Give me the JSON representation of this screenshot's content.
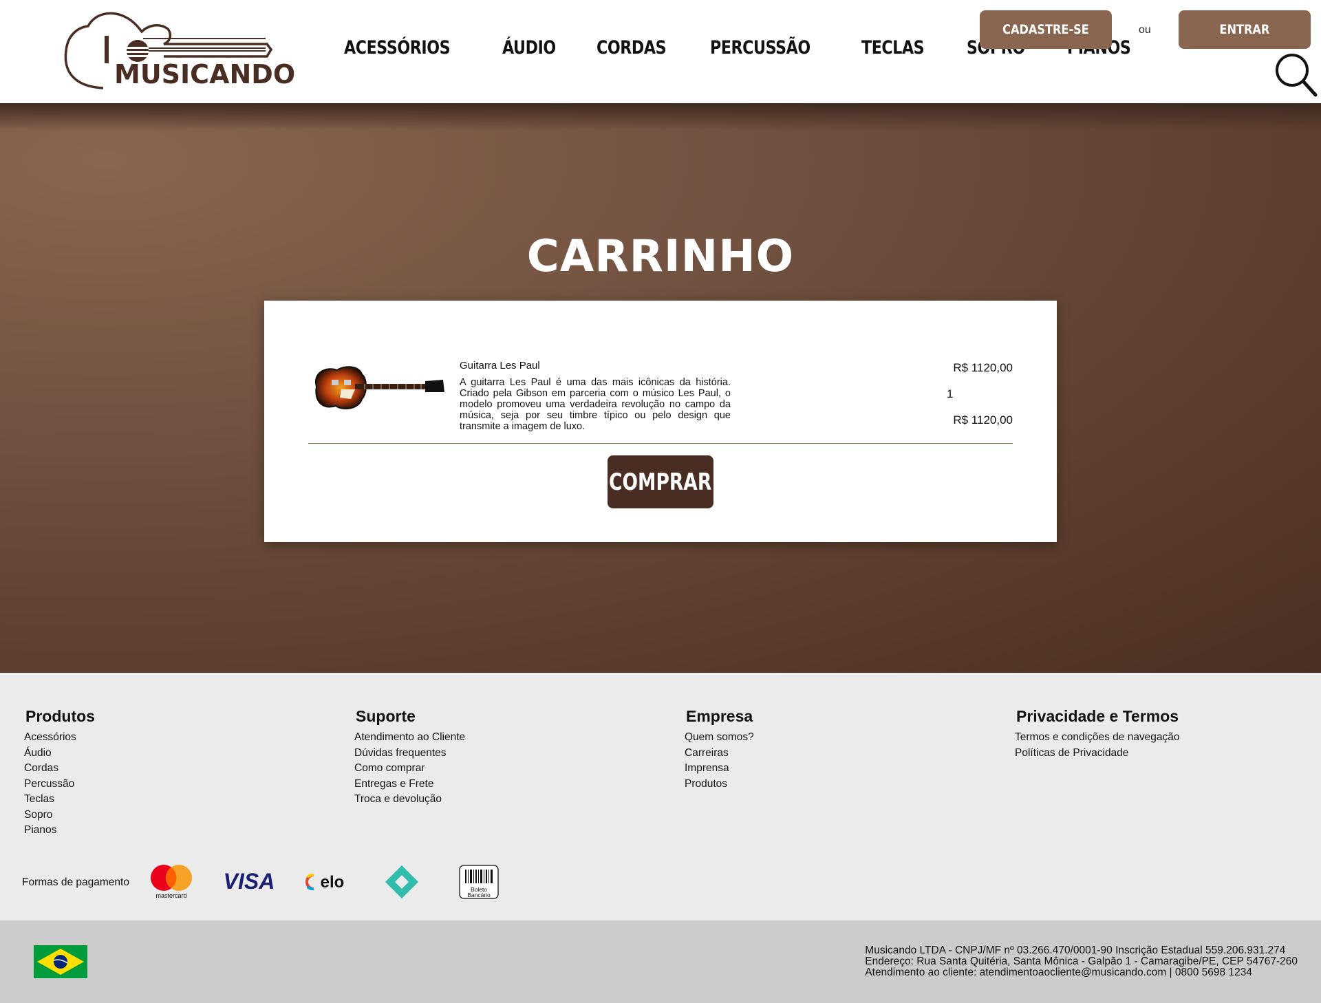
{
  "header": {
    "logo_text": "MUSICANDO",
    "nav": [
      "ACESSÓRIOS",
      "ÁUDIO",
      "CORDAS",
      "PERCUSSÃO",
      "TECLAS",
      "SOPRO",
      "PIANOS"
    ],
    "signup_label": "CADASTRE-SE",
    "or_label": "ou",
    "login_label": "ENTRAR"
  },
  "cart": {
    "title": "CARRINHO",
    "item": {
      "name": "Guitarra Les Paul",
      "description": "A guitarra Les Paul é uma das mais icônicas da história. Criado pela Gibson em parceria com o músico Les Paul, o modelo promoveu uma verdadeira revolução no campo da música, seja por seu timbre típico ou pelo design que transmite a imagem de luxo.",
      "unit_price": "R$ 1120,00",
      "quantity": "1",
      "total_price": "R$ 1120,00"
    },
    "buy_label": "COMPRAR"
  },
  "footer": {
    "columns": [
      {
        "title": "Produtos",
        "links": [
          "Acessórios",
          "Áudio",
          "Cordas",
          "Percussão",
          "Teclas",
          "Sopro",
          "Pianos"
        ]
      },
      {
        "title": "Suporte",
        "links": [
          "Atendimento ao Cliente",
          "Dúvidas frequentes",
          "Como comprar",
          "Entregas e Frete",
          "Troca e devolução"
        ]
      },
      {
        "title": "Empresa",
        "links": [
          "Quem somos?",
          "Carreiras",
          "Imprensa",
          "Produtos"
        ]
      },
      {
        "title": "Privacidade e Termos",
        "links": [
          "Termos e condições de navegação",
          "Políticas de Privacidade"
        ]
      }
    ],
    "payment_label": "Formas de pagamento",
    "payment_methods": [
      "mastercard",
      "VISA",
      "elo",
      "pix",
      "Boleto Bancário"
    ],
    "legal": [
      "Musicando LTDA - CNPJ/MF nº 03.266.470/0001-90 Inscrição Estadual 559.206.931.274",
      "Endereço: Rua Santa Quitéria, Santa Mônica - Galpão 1 - Camaragibe/PE, CEP 54767-260",
      "Atendimento ao cliente: atendimentoaocliente@musicando.com | 0800 5698 1234"
    ]
  },
  "colors": {
    "brand_brown": "#8a6550",
    "dark_brown": "#4a2d22"
  },
  "icons": [
    "guitar-logo-icon",
    "search-icon",
    "brazil-flag-icon"
  ]
}
